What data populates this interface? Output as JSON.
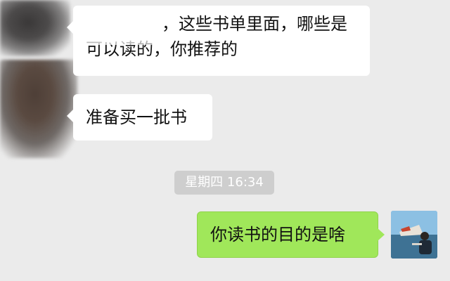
{
  "messages": [
    {
      "side": "left",
      "lines": [
        "，这些书单里面，哪些是",
        "可以读的，你推荐的"
      ]
    },
    {
      "side": "left",
      "text": "准备买一批书"
    },
    {
      "side": "right",
      "text": "你读书的目的是啥"
    }
  ],
  "timestamp": "星期四 16:34",
  "colors": {
    "background": "#ebebeb",
    "incoming_bubble": "#ffffff",
    "outgoing_bubble": "#a0e75a",
    "timestamp_pill": "#cecece"
  },
  "icons": {
    "incoming_avatar": "blurred-avatar",
    "outgoing_avatar": "photo-avatar"
  }
}
